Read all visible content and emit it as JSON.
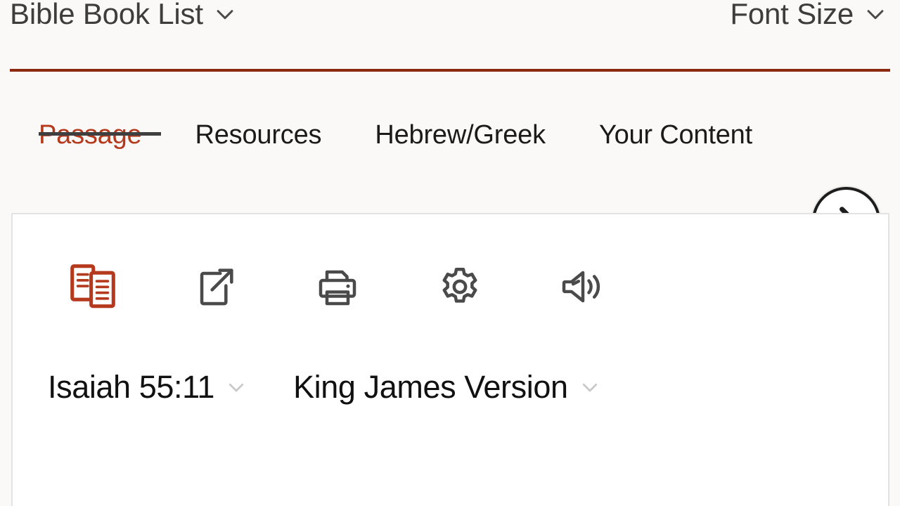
{
  "header": {
    "book_list": {
      "label": "Bible Book List",
      "icon": "chevron-down-icon"
    },
    "font_size": {
      "label": "Font Size",
      "icon": "chevron-down-icon"
    },
    "rule_color": "#8c2a10"
  },
  "tabs": {
    "items": [
      {
        "label": "Passage",
        "active": true
      },
      {
        "label": "Resources",
        "active": false
      },
      {
        "label": "Hebrew/Greek",
        "active": false
      },
      {
        "label": "Your Content",
        "active": false
      }
    ],
    "active_color": "#b5391c",
    "inactive_color": "#1b1b1b",
    "underline_color": "#3f3f3f",
    "next_button": {
      "icon": "chevron-right-icon",
      "aria_label": "Next tabs"
    }
  },
  "toolbar": {
    "actions": [
      {
        "name": "parallel-view-icon",
        "label": "Parallel",
        "color": "#b5391c"
      },
      {
        "name": "share-icon",
        "label": "Share",
        "color": "#4a4a4a"
      },
      {
        "name": "print-icon",
        "label": "Print",
        "color": "#4a4a4a"
      },
      {
        "name": "gear-icon",
        "label": "Settings",
        "color": "#4a4a4a"
      },
      {
        "name": "speaker-icon",
        "label": "Listen",
        "color": "#4a4a4a"
      }
    ]
  },
  "passage": {
    "reference": {
      "value": "Isaiah 55:11",
      "icon": "chevron-down-icon"
    },
    "version": {
      "value": "King James Version",
      "icon": "chevron-down-icon"
    }
  },
  "colors": {
    "page_background": "#faf9f7",
    "content_background": "#ffffff",
    "panel_border": "#e3e3e3",
    "accent_red": "#b5391c",
    "rule_red": "#8c2a10",
    "text_dark": "#1b1b1b",
    "chevron_gray": "#c9c9c9"
  }
}
